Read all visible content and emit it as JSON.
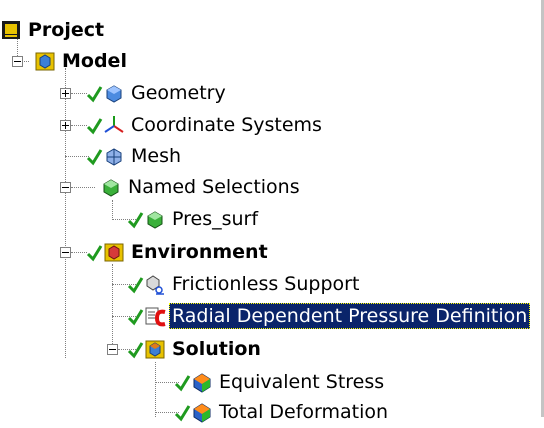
{
  "tree": {
    "nodes": [
      {
        "label": "Project",
        "bold": true,
        "selected": false,
        "checked": false,
        "icon": "project-icon",
        "expander": "none"
      },
      {
        "label": "Model",
        "bold": true,
        "selected": false,
        "checked": false,
        "icon": "model-icon",
        "expander": "minus"
      },
      {
        "label": "Geometry",
        "bold": false,
        "selected": false,
        "checked": true,
        "icon": "geometry-icon",
        "expander": "plus"
      },
      {
        "label": "Coordinate Systems",
        "bold": false,
        "selected": false,
        "checked": true,
        "icon": "coordinate-systems-icon",
        "expander": "plus"
      },
      {
        "label": "Mesh",
        "bold": false,
        "selected": false,
        "checked": true,
        "icon": "mesh-icon",
        "expander": "none"
      },
      {
        "label": "Named Selections",
        "bold": false,
        "selected": false,
        "checked": false,
        "icon": "named-selections-icon",
        "expander": "minus"
      },
      {
        "label": "Pres_surf",
        "bold": false,
        "selected": false,
        "checked": true,
        "icon": "named-selection-icon",
        "expander": "none"
      },
      {
        "label": "Environment",
        "bold": true,
        "selected": false,
        "checked": true,
        "icon": "environment-icon",
        "expander": "minus"
      },
      {
        "label": "Frictionless Support",
        "bold": false,
        "selected": false,
        "checked": true,
        "icon": "frictionless-support-icon",
        "expander": "none"
      },
      {
        "label": "Radial Dependent Pressure Definition",
        "bold": false,
        "selected": true,
        "checked": true,
        "icon": "command-snippet-icon",
        "expander": "none"
      },
      {
        "label": "Solution",
        "bold": true,
        "selected": false,
        "checked": true,
        "icon": "solution-icon",
        "expander": "minus"
      },
      {
        "label": "Equivalent Stress",
        "bold": false,
        "selected": false,
        "checked": true,
        "icon": "equivalent-stress-icon",
        "expander": "none"
      },
      {
        "label": "Total Deformation",
        "bold": false,
        "selected": false,
        "checked": true,
        "icon": "total-deformation-icon",
        "expander": "none"
      }
    ]
  },
  "colors": {
    "selection_bg": "#0a246a",
    "selection_text": "#ffffff",
    "check_green": "#1f9a1f",
    "tree_line": "#808080",
    "bold_accent_yellow": "#e8c200"
  }
}
